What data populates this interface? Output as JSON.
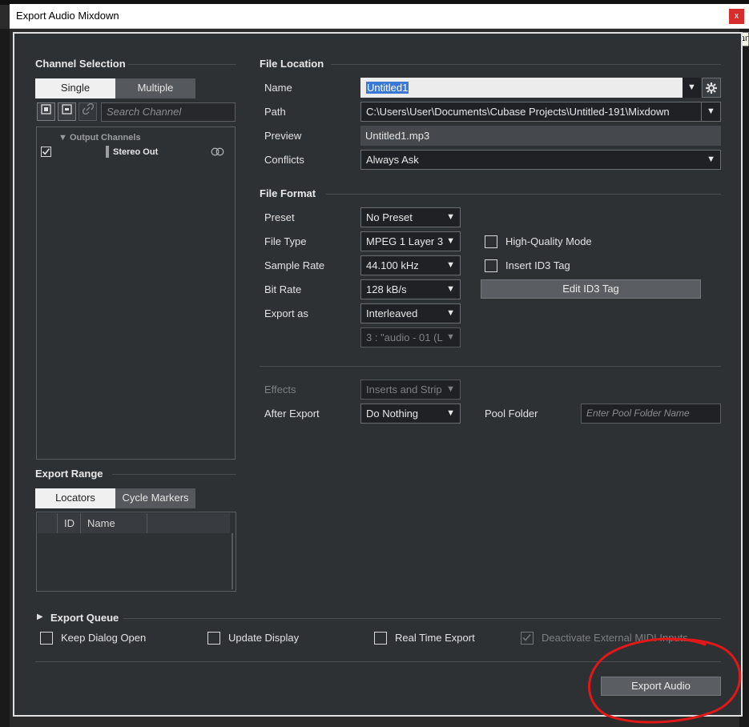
{
  "window": {
    "title": "Export Audio Mixdown",
    "close_label": "x",
    "tooltip_fragment": "רוב"
  },
  "channel_selection": {
    "title": "Channel Selection",
    "mode_single": "Single",
    "mode_multiple": "Multiple",
    "search_placeholder": "Search Channel",
    "group_label": "Output Channels",
    "channel_name": "Stereo Out"
  },
  "export_range": {
    "title": "Export Range",
    "tab_locators": "Locators",
    "tab_cycle_markers": "Cycle Markers",
    "col_id": "ID",
    "col_name": "Name"
  },
  "file_location": {
    "title": "File Location",
    "name_label": "Name",
    "name_value": "Untitled1",
    "path_label": "Path",
    "path_value": "C:\\Users\\User\\Documents\\Cubase Projects\\Untitled-191\\Mixdown",
    "preview_label": "Preview",
    "preview_value": "Untitled1.mp3",
    "conflicts_label": "Conflicts",
    "conflicts_value": "Always Ask"
  },
  "file_format": {
    "title": "File Format",
    "preset_label": "Preset",
    "preset_value": "No Preset",
    "file_type_label": "File Type",
    "file_type_value": "MPEG 1 Layer 3",
    "sample_rate_label": "Sample Rate",
    "sample_rate_value": "44.100 kHz",
    "bit_rate_label": "Bit Rate",
    "bit_rate_value": "128 kB/s",
    "export_as_label": "Export as",
    "export_as_value": "Interleaved",
    "channel_value": "3 : \"audio - 01 (L",
    "hq_mode_label": "High-Quality Mode",
    "id3_label": "Insert ID3 Tag",
    "edit_id3_label": "Edit ID3 Tag"
  },
  "post": {
    "effects_label": "Effects",
    "effects_value": "Inserts and Strip",
    "after_export_label": "After Export",
    "after_export_value": "Do Nothing",
    "pool_folder_label": "Pool Folder",
    "pool_folder_placeholder": "Enter Pool Folder Name"
  },
  "queue": {
    "title": "Export Queue",
    "keep_open": "Keep Dialog Open",
    "update_display": "Update Display",
    "real_time": "Real Time Export",
    "deactivate_midi": "Deactivate External MIDI Inputs"
  },
  "footer": {
    "export_button": "Export Audio"
  },
  "colors": {
    "accent_selection": "#3a78d6",
    "annotation": "#e01818",
    "dialog_bg": "#2e3134"
  }
}
